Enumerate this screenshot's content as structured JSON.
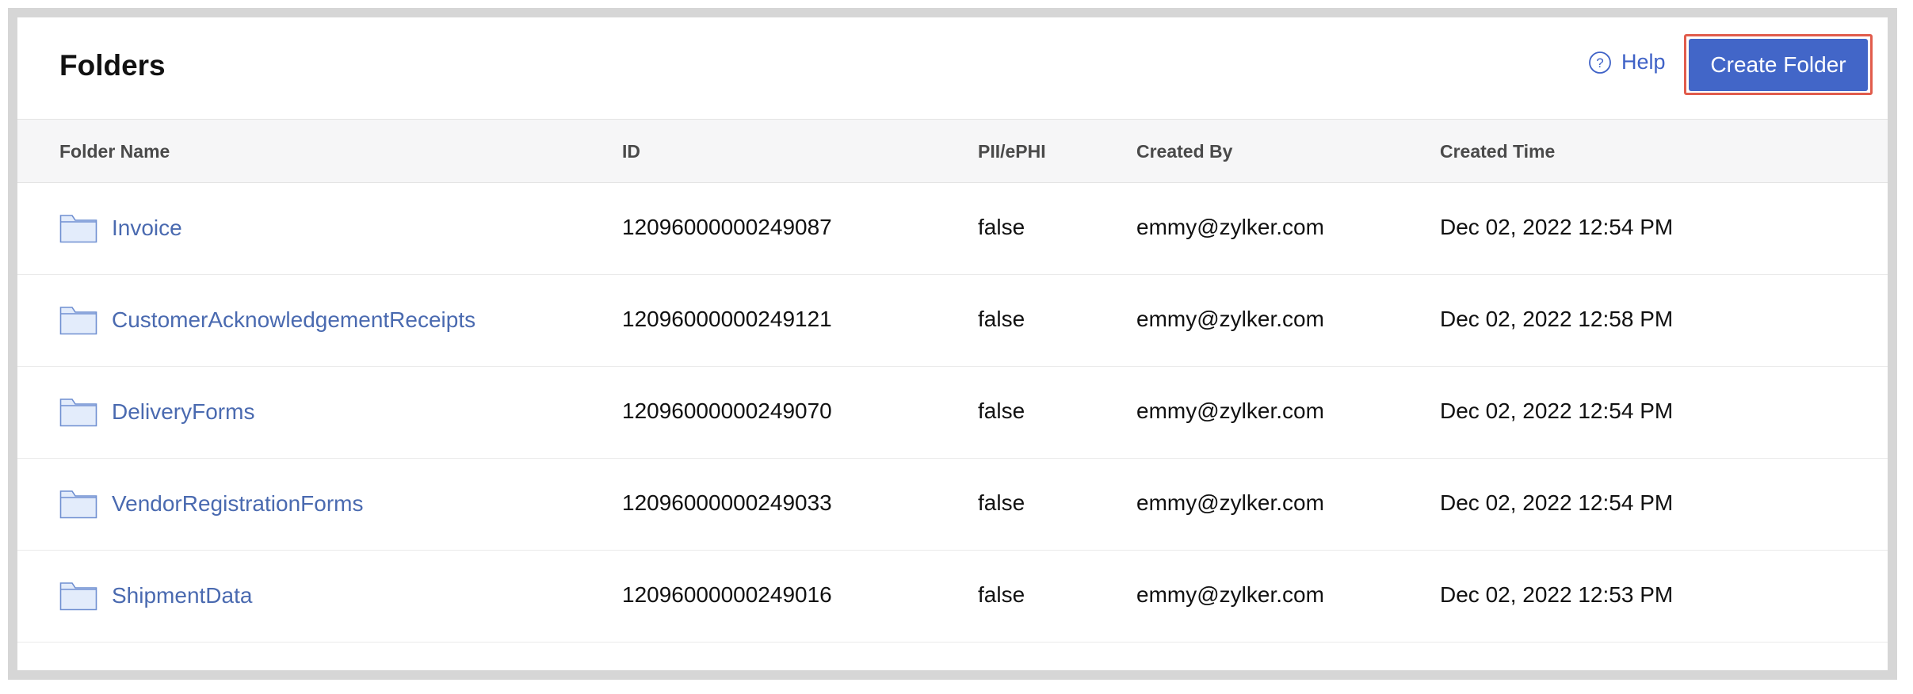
{
  "header": {
    "title": "Folders",
    "help_label": "Help",
    "create_button_label": "Create Folder"
  },
  "table": {
    "columns": [
      "Folder Name",
      "ID",
      "PII/ePHI",
      "Created By",
      "Created Time"
    ],
    "rows": [
      {
        "name": "Invoice",
        "id": "12096000000249087",
        "pii": "false",
        "created_by": "emmy@zylker.com",
        "created_time": "Dec 02, 2022 12:54 PM"
      },
      {
        "name": "CustomerAcknowledgementReceipts",
        "id": "12096000000249121",
        "pii": "false",
        "created_by": "emmy@zylker.com",
        "created_time": "Dec 02, 2022 12:58 PM"
      },
      {
        "name": "DeliveryForms",
        "id": "12096000000249070",
        "pii": "false",
        "created_by": "emmy@zylker.com",
        "created_time": "Dec 02, 2022 12:54 PM"
      },
      {
        "name": "VendorRegistrationForms",
        "id": "12096000000249033",
        "pii": "false",
        "created_by": "emmy@zylker.com",
        "created_time": "Dec 02, 2022 12:54 PM"
      },
      {
        "name": "ShipmentData",
        "id": "12096000000249016",
        "pii": "false",
        "created_by": "emmy@zylker.com",
        "created_time": "Dec 02, 2022 12:53 PM"
      }
    ]
  },
  "icons": {
    "help": "question-circle-icon",
    "folder": "folder-icon"
  },
  "colors": {
    "accent": "#4266c8",
    "link": "#4a6ab0",
    "highlight_border": "#e15c4c"
  }
}
